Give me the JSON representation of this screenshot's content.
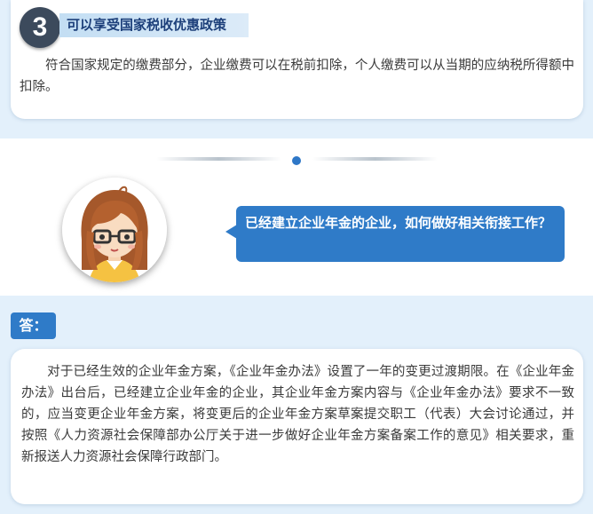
{
  "section": {
    "number": "3",
    "title": "可以享受国家税收优惠政策",
    "body": "符合国家规定的缴费部分，企业缴费可以在税前扣除，个人缴费可以从当期的应纳税所得额中扣除。"
  },
  "question": {
    "text": "已经建立企业年金的企业，如何做好相关衔接工作？"
  },
  "answer": {
    "label": "答：",
    "body": "对于已经生效的企业年金方案，《企业年金办法》设置了一年的变更过渡期限。在《企业年金办法》出台后，已经建立企业年金的企业，其企业年金方案内容与《企业年金办法》要求不一致的，应当变更企业年金方案，将变更后的企业年金方案草案提交职工（代表）大会讨论通过，并按照《人力资源社会保障部办公厅关于进一步做好企业年金方案备案工作的意见》相关要求，重新报送人力资源社会保障行政部门。"
  },
  "colors": {
    "accent_blue": "#2f7bc8",
    "band_background": "#e3f0fb",
    "number_circle": "#3c4a5c",
    "title_text": "#1c3f7a"
  },
  "icons": {
    "avatar": "cartoon-girl-with-glasses-avatar"
  }
}
